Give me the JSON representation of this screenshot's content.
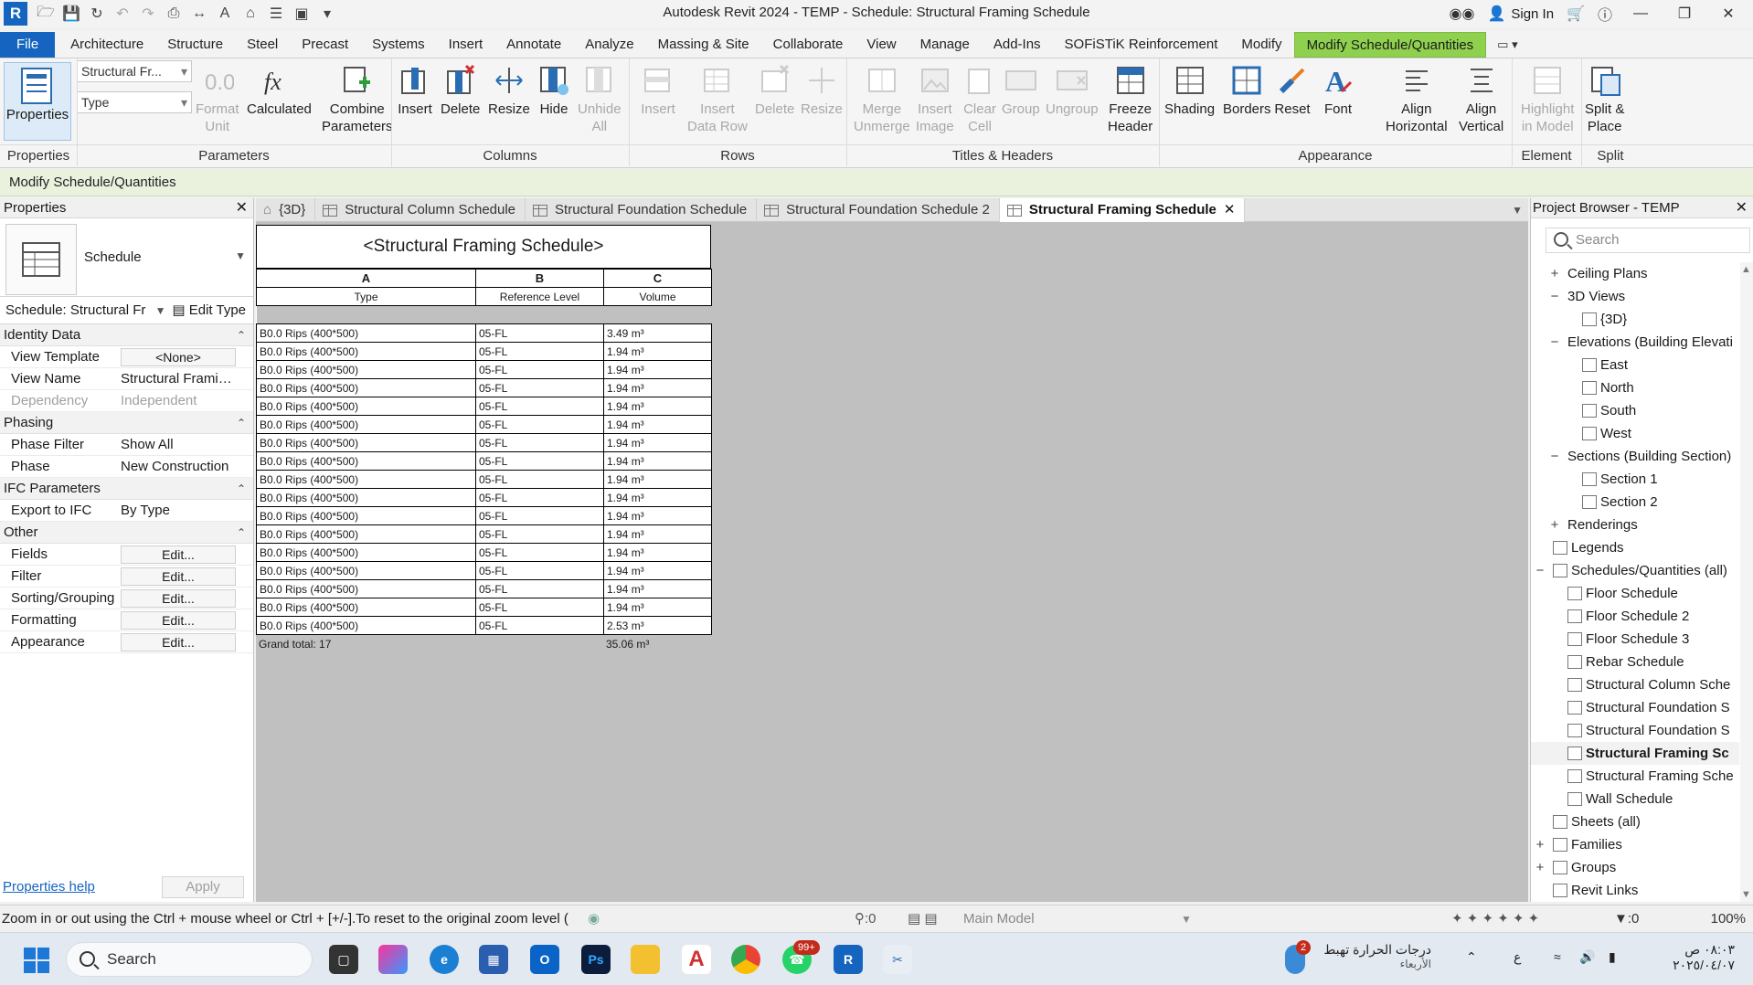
{
  "app": {
    "logo": "R",
    "title": "Autodesk Revit 2024 - TEMP - Schedule: Structural Framing Schedule",
    "sign_in": "Sign In"
  },
  "ribbon_tabs": [
    "File",
    "Architecture",
    "Structure",
    "Steel",
    "Precast",
    "Systems",
    "Insert",
    "Annotate",
    "Analyze",
    "Massing & Site",
    "Collaborate",
    "View",
    "Manage",
    "Add-Ins",
    "SOFiSTiK Reinforcement",
    "Modify",
    "Modify Schedule/Quantities"
  ],
  "ribbon": {
    "properties_label": "Properties",
    "combo_top": "Structural Fr...",
    "combo_bottom": "Type",
    "buttons": {
      "format_unit": "Format\nUnit",
      "calculated": "Calculated",
      "combine_parameters": "Combine\nParameters",
      "insert": "Insert",
      "delete": "Delete",
      "resize": "Resize",
      "hide": "Hide",
      "unhide_all": "Unhide\nAll",
      "row_insert": "Insert",
      "insert_data_row": "Insert\nData Row",
      "row_delete": "Delete",
      "row_resize": "Resize",
      "merge_unmerge": "Merge\nUnmerge",
      "insert_image": "Insert\nImage",
      "clear_cell": "Clear\nCell",
      "group": "Group",
      "ungroup": "Ungroup",
      "freeze_header": "Freeze\nHeader",
      "shading": "Shading",
      "borders": "Borders",
      "reset": "Reset",
      "font": "Font",
      "align_horizontal": "Align\nHorizontal",
      "align_vertical": "Align\nVertical",
      "highlight_in_model": "Highlight\nin Model",
      "split_place": "Split &\nPlace"
    },
    "groups": {
      "properties": "Properties",
      "parameters": "Parameters",
      "columns": "Columns",
      "rows": "Rows",
      "titles_headers": "Titles & Headers",
      "appearance": "Appearance",
      "element": "Element",
      "split": "Split"
    }
  },
  "context_bar": "Modify Schedule/Quantities",
  "properties": {
    "header": "Properties",
    "type_name": "Schedule",
    "instance_selector": "Schedule: Structural Fr",
    "edit_type": "Edit Type",
    "groups": [
      {
        "name": "Identity Data",
        "rows": [
          {
            "name": "View Template",
            "value": "<None>",
            "button": true
          },
          {
            "name": "View Name",
            "value": "Structural Framin..."
          },
          {
            "name": "Dependency",
            "value": "Independent",
            "dim": true
          }
        ]
      },
      {
        "name": "Phasing",
        "rows": [
          {
            "name": "Phase Filter",
            "value": "Show All"
          },
          {
            "name": "Phase",
            "value": "New Construction"
          }
        ]
      },
      {
        "name": "IFC Parameters",
        "rows": [
          {
            "name": "Export to IFC",
            "value": "By Type"
          }
        ]
      },
      {
        "name": "Other",
        "rows": [
          {
            "name": "Fields",
            "value": "Edit...",
            "button": true
          },
          {
            "name": "Filter",
            "value": "Edit...",
            "button": true
          },
          {
            "name": "Sorting/Grouping",
            "value": "Edit...",
            "button": true
          },
          {
            "name": "Formatting",
            "value": "Edit...",
            "button": true
          },
          {
            "name": "Appearance",
            "value": "Edit...",
            "button": true
          }
        ]
      }
    ],
    "help_link": "Properties help",
    "apply": "Apply"
  },
  "doc_tabs": [
    {
      "label": "{3D}",
      "icon": "home-icon"
    },
    {
      "label": "Structural Column Schedule",
      "icon": "schedule-icon"
    },
    {
      "label": "Structural Foundation Schedule",
      "icon": "schedule-icon"
    },
    {
      "label": "Structural Foundation Schedule 2",
      "icon": "schedule-icon"
    },
    {
      "label": "Structural Framing Schedule",
      "icon": "schedule-icon",
      "active": true
    }
  ],
  "schedule": {
    "title": "<Structural Framing Schedule>",
    "column_letters": [
      "A",
      "B",
      "C"
    ],
    "headers": [
      "Type",
      "Reference Level",
      "Volume"
    ],
    "rows": [
      [
        "B0.0 Rips (400*500)",
        "05-FL",
        "3.49 m³"
      ],
      [
        "B0.0 Rips (400*500)",
        "05-FL",
        "1.94 m³"
      ],
      [
        "B0.0 Rips (400*500)",
        "05-FL",
        "1.94 m³"
      ],
      [
        "B0.0 Rips (400*500)",
        "05-FL",
        "1.94 m³"
      ],
      [
        "B0.0 Rips (400*500)",
        "05-FL",
        "1.94 m³"
      ],
      [
        "B0.0 Rips (400*500)",
        "05-FL",
        "1.94 m³"
      ],
      [
        "B0.0 Rips (400*500)",
        "05-FL",
        "1.94 m³"
      ],
      [
        "B0.0 Rips (400*500)",
        "05-FL",
        "1.94 m³"
      ],
      [
        "B0.0 Rips (400*500)",
        "05-FL",
        "1.94 m³"
      ],
      [
        "B0.0 Rips (400*500)",
        "05-FL",
        "1.94 m³"
      ],
      [
        "B0.0 Rips (400*500)",
        "05-FL",
        "1.94 m³"
      ],
      [
        "B0.0 Rips (400*500)",
        "05-FL",
        "1.94 m³"
      ],
      [
        "B0.0 Rips (400*500)",
        "05-FL",
        "1.94 m³"
      ],
      [
        "B0.0 Rips (400*500)",
        "05-FL",
        "1.94 m³"
      ],
      [
        "B0.0 Rips (400*500)",
        "05-FL",
        "1.94 m³"
      ],
      [
        "B0.0 Rips (400*500)",
        "05-FL",
        "1.94 m³"
      ],
      [
        "B0.0 Rips (400*500)",
        "05-FL",
        "2.53 m³"
      ]
    ],
    "grand_total_label": "Grand total: 17",
    "grand_total_value": "35.06 m³"
  },
  "browser": {
    "header": "Project Browser - TEMP",
    "search_placeholder": "Search",
    "nodes": [
      {
        "label": "Ceiling Plans",
        "level": 0,
        "exp": "+"
      },
      {
        "label": "3D Views",
        "level": 0,
        "exp": "−"
      },
      {
        "label": "{3D}",
        "level": 1,
        "view": true
      },
      {
        "label": "Elevations (Building Elevati",
        "level": 0,
        "exp": "−"
      },
      {
        "label": "East",
        "level": 1,
        "view": true
      },
      {
        "label": "North",
        "level": 1,
        "view": true
      },
      {
        "label": "South",
        "level": 1,
        "view": true
      },
      {
        "label": "West",
        "level": 1,
        "view": true
      },
      {
        "label": "Sections (Building Section)",
        "level": 0,
        "exp": "−"
      },
      {
        "label": "Section 1",
        "level": 1,
        "view": true
      },
      {
        "label": "Section 2",
        "level": 1,
        "view": true
      },
      {
        "label": "Renderings",
        "level": 0,
        "exp": "+"
      },
      {
        "label": "Legends",
        "level": -1,
        "icon": true
      },
      {
        "label": "Schedules/Quantities (all)",
        "level": -1,
        "exp": "−",
        "icon": true
      },
      {
        "label": "Floor Schedule",
        "level": 2,
        "view": true
      },
      {
        "label": "Floor Schedule 2",
        "level": 2,
        "view": true
      },
      {
        "label": "Floor Schedule 3",
        "level": 2,
        "view": true
      },
      {
        "label": "Rebar Schedule",
        "level": 2,
        "view": true
      },
      {
        "label": "Structural Column Sche",
        "level": 2,
        "view": true
      },
      {
        "label": "Structural Foundation S",
        "level": 2,
        "view": true
      },
      {
        "label": "Structural Foundation S",
        "level": 2,
        "view": true
      },
      {
        "label": "Structural Framing Sc",
        "level": 2,
        "view": true,
        "selected": true
      },
      {
        "label": "Structural Framing Sche",
        "level": 2,
        "view": true
      },
      {
        "label": "Wall Schedule",
        "level": 2,
        "view": true
      },
      {
        "label": "Sheets (all)",
        "level": -1,
        "icon": true
      },
      {
        "label": "Families",
        "level": -1,
        "exp": "+",
        "icon": true
      },
      {
        "label": "Groups",
        "level": -1,
        "exp": "+",
        "icon": true
      },
      {
        "label": "Revit Links",
        "level": -1,
        "icon": true
      }
    ]
  },
  "status": {
    "message": "Zoom in or out using the Ctrl + mouse wheel or Ctrl + [+/-].To reset to the original zoom level (",
    "worksets": ":0",
    "model": "Main Model",
    "filter_count": ":0",
    "zoom": "100%"
  },
  "taskbar": {
    "search": "Search",
    "weather_line1": "درجات الحرارة تهبط",
    "weather_line2": "الأربعاء",
    "weather_badge": "2",
    "lang": "ع",
    "time": "٠٨:٠٣ ص",
    "date": "٢٠٢٥/٠٤/٠٧",
    "whatsapp_badge": "99+"
  },
  "colors": {
    "accent_blue": "#1565c0",
    "modify_tab_green": "#8fd14f",
    "schedule_bg": "#c0c0c0"
  }
}
